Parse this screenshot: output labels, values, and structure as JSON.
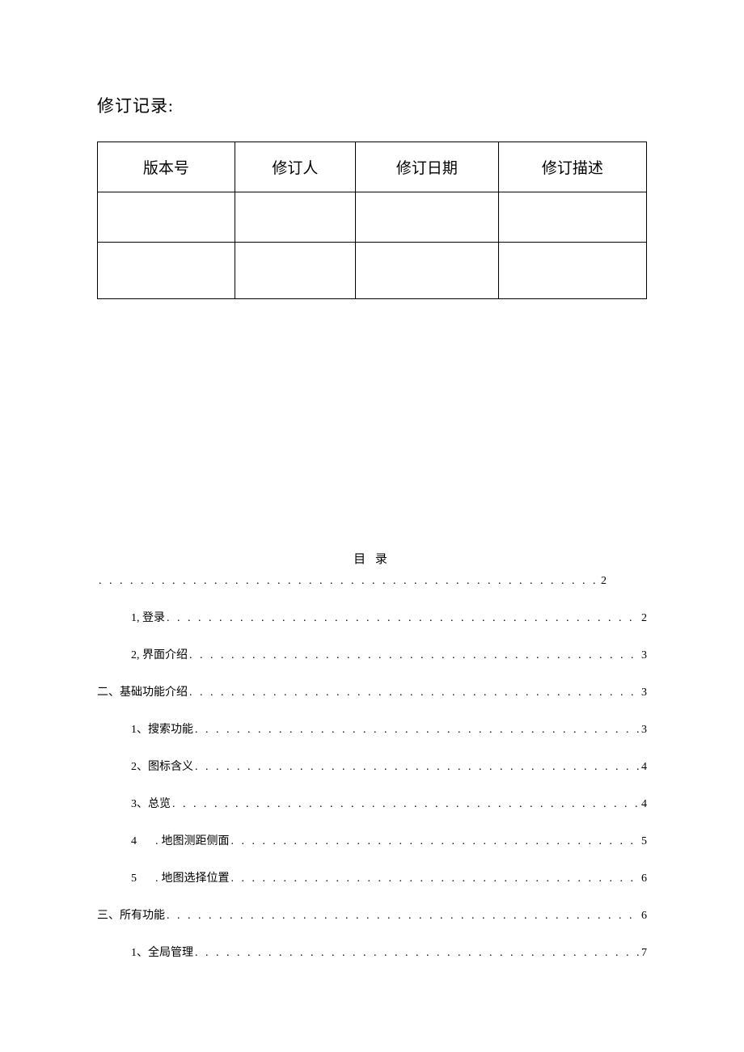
{
  "revision": {
    "title": "修订记录:",
    "headers": {
      "version": "版本号",
      "editor": "修订人",
      "date": "修订日期",
      "description": "修订描述"
    }
  },
  "toc": {
    "title": "目 录",
    "entries": {
      "e0": {
        "label": "",
        "page": "2"
      },
      "e1": {
        "num": "1,",
        "label": "登录",
        "page": "2"
      },
      "e2": {
        "num": "2,",
        "label": "界面介绍",
        "page": "3"
      },
      "e3": {
        "label": "二、基础功能介绍",
        "page": "3"
      },
      "e4": {
        "num": "1、",
        "label": "搜索功能",
        "page": "3"
      },
      "e5": {
        "num": "2、",
        "label": "图标含义",
        "page": "4"
      },
      "e6": {
        "num": "3、",
        "label": "总览",
        "page": "4"
      },
      "e7": {
        "num": "4",
        "sep": ".",
        "label": "地图测距侧面",
        "page": "5"
      },
      "e8": {
        "num": "5",
        "sep": ".",
        "label": "地图选择位置",
        "page": "6"
      },
      "e9": {
        "label": "三、所有功能",
        "page": "6"
      },
      "e10": {
        "num": "1、",
        "label": "全局管理",
        "page": "7"
      }
    }
  }
}
